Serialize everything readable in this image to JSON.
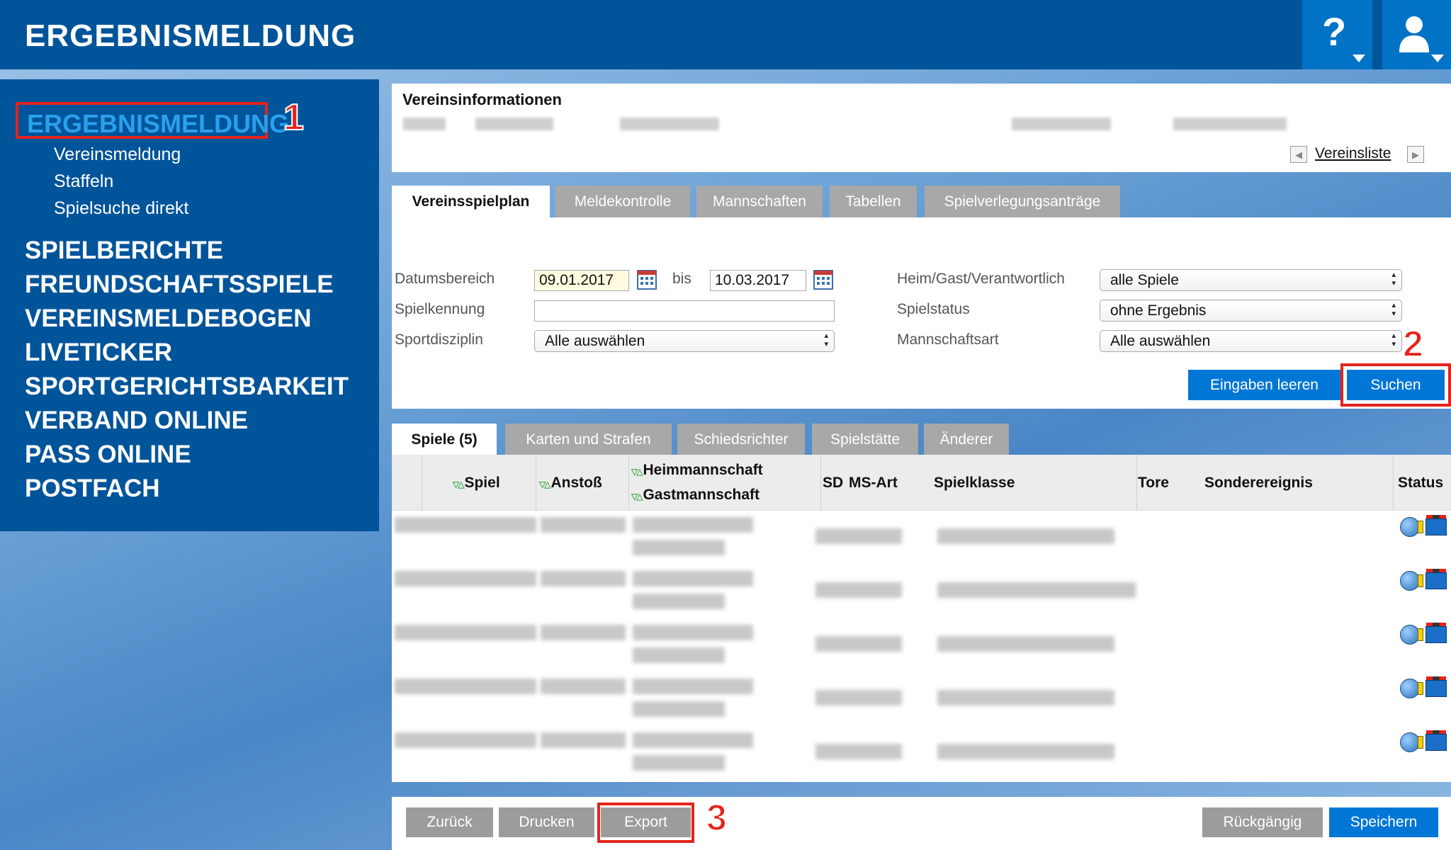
{
  "header": {
    "title": "ERGEBNISMELDUNG",
    "help_symbol": "?"
  },
  "sidebar": {
    "active_section": "ERGEBNISMELDUNG",
    "sub_items": [
      "Vereinsmeldung",
      "Staffeln",
      "Spielsuche direkt"
    ],
    "sections": [
      "SPIELBERICHTE",
      "FREUNDSCHAFTSSPIELE",
      "VEREINSMELDEBOGEN",
      "LIVETICKER",
      "SPORTGERICHTSBARKEIT",
      "VERBAND ONLINE",
      "PASS ONLINE",
      "POSTFACH"
    ]
  },
  "callouts": [
    "1",
    "2",
    "3"
  ],
  "club_info": {
    "title": "Vereinsinformationen",
    "club_list_link": "Vereinsliste"
  },
  "main_tabs": [
    "Vereinsspielplan",
    "Meldekontrolle",
    "Mannschaften",
    "Tabellen",
    "Spielverlegungsanträge"
  ],
  "filters": {
    "date_range_label": "Datumsbereich",
    "date_from": "09.01.2017",
    "to_label": "bis",
    "date_to": "10.03.2017",
    "game_id_label": "Spielkennung",
    "game_id_value": "",
    "discipline_label": "Sportdisziplin",
    "discipline_value": "Alle auswählen",
    "home_away_label": "Heim/Gast/Verantwortlich",
    "home_away_value": "alle Spiele",
    "status_label": "Spielstatus",
    "status_value": "ohne Ergebnis",
    "team_type_label": "Mannschaftsart",
    "team_type_value": "Alle auswählen",
    "clear_button": "Eingaben leeren",
    "search_button": "Suchen"
  },
  "result_tabs": [
    "Spiele (5)",
    "Karten und Strafen",
    "Schiedsrichter",
    "Spielstätte",
    "Änderer"
  ],
  "table": {
    "sort_marker": "▽△",
    "columns": {
      "game": "Spiel",
      "kickoff": "Anstoß",
      "home": "Heimmannschaft",
      "away": "Gastmannschaft",
      "sd": "SD",
      "match_type": "MS-Art",
      "league": "Spielklasse",
      "goals": "Tore",
      "special": "Sonderereignis",
      "status": "Status"
    },
    "row_count": 5,
    "row_status_icons": [
      "globe-icon",
      "scoreboard-icon"
    ]
  },
  "footer": {
    "back": "Zurück",
    "print": "Drucken",
    "export": "Export",
    "undo": "Rückgängig",
    "save": "Speichern"
  },
  "colors": {
    "header_blue": "#00549a",
    "accent_blue": "#0076d6",
    "highlight_red": "#e5231b",
    "tab_gray": "#a8a8a8"
  }
}
